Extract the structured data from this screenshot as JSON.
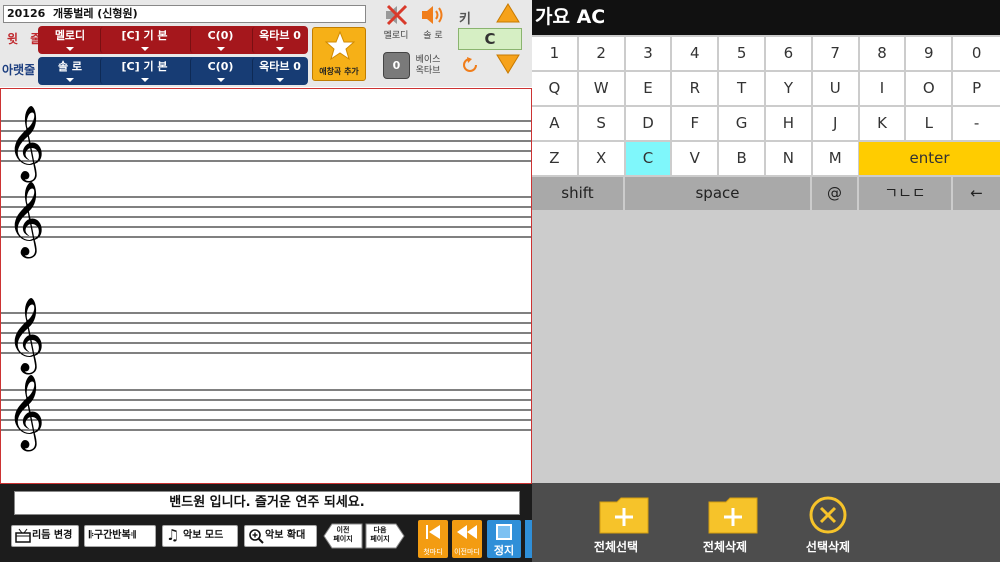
{
  "song": {
    "number": "20126",
    "title": "개똥벌레 (신형원)"
  },
  "upper_row": {
    "label": "윗 줄",
    "part": "멜로디",
    "rhythm": "[C] 기   본",
    "chord": "C(0)",
    "octave": "옥타브 0"
  },
  "lower_row": {
    "label": "아랫줄",
    "part": "솔 로",
    "rhythm": "[C] 기   본",
    "chord": "C(0)",
    "octave": "옥타브 0"
  },
  "favorite": {
    "label": "애창곡 추가"
  },
  "mute": {
    "melody": "멜로디",
    "solo": "솔 로"
  },
  "key": {
    "label": "키",
    "value": "C"
  },
  "bass": {
    "value": "0",
    "label_line1": "베이스",
    "label_line2": "옥타브"
  },
  "status_message": "밴드원 입니다. 즐거운 연주 되세요.",
  "toolbar": {
    "rhythm_change": "리듬 변경",
    "section_repeat": "구간반복",
    "score_mode": "악보 모드",
    "score_zoom": "악보 확대",
    "prev_page_l1": "이전",
    "prev_page_l2": "페이지",
    "next_page_l1": "다음",
    "next_page_l2": "페이지",
    "first_measure": "첫마디",
    "prev_measure": "이전마디",
    "stop": "정지"
  },
  "search": {
    "query": "가요 AC"
  },
  "keyboard": {
    "row1": [
      "1",
      "2",
      "3",
      "4",
      "5",
      "6",
      "7",
      "8",
      "9",
      "0"
    ],
    "row2": [
      "Q",
      "W",
      "E",
      "R",
      "T",
      "Y",
      "U",
      "I",
      "O",
      "P"
    ],
    "row3": [
      "A",
      "S",
      "D",
      "F",
      "G",
      "H",
      "J",
      "K",
      "L",
      "-"
    ],
    "row4": [
      "Z",
      "X",
      "C",
      "V",
      "B",
      "N",
      "M"
    ],
    "highlighted_key": "C",
    "enter": "enter",
    "shift": "shift",
    "space": "space",
    "at": "@",
    "hangul": "ㄱㄴㄷ",
    "backspace": "←"
  },
  "actions": {
    "select_all": "전체선택",
    "delete_all": "전체삭제",
    "delete_selected": "선택삭제"
  },
  "colors": {
    "red_row": "#a5171c",
    "blue_row": "#173c74",
    "accent_orange": "#f6b017",
    "highlight_key": "#7ff7fb",
    "enter_key": "#ffcc00"
  }
}
